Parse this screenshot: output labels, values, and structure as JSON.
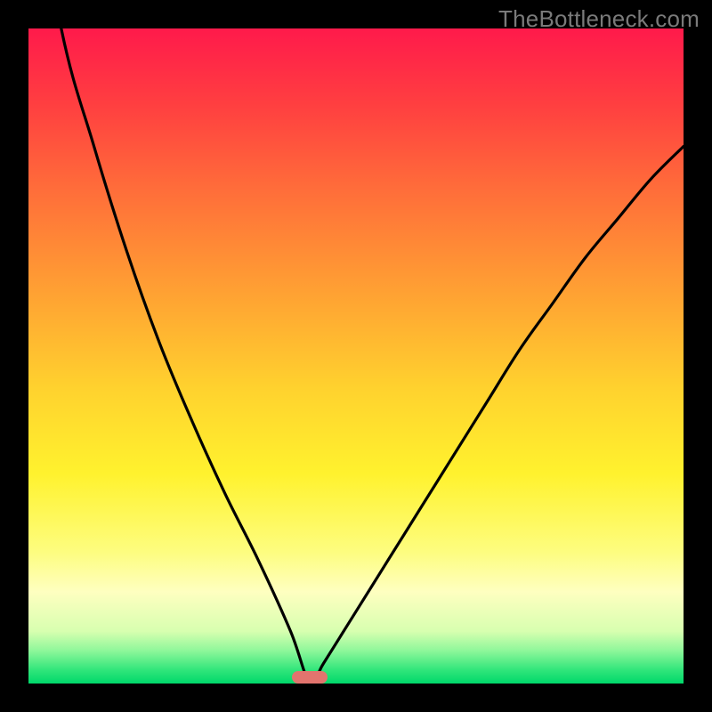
{
  "watermark": "TheBottleneck.com",
  "colors": {
    "frame": "#000000",
    "curve": "#000000",
    "marker": "#e2746e",
    "gradient_top": "#ff1a4b",
    "gradient_bottom": "#00d86a"
  },
  "chart_data": {
    "type": "line",
    "title": "",
    "xlabel": "",
    "ylabel": "",
    "xlim": [
      0,
      100
    ],
    "ylim": [
      0,
      100
    ],
    "grid": false,
    "legend": false,
    "note": "Bottleneck-style curve. Y ≈ 0 at the optimum (green band) and rises toward 100 (red) as x moves away from the optimum. Values are read off the gradient/position; no axis ticks are shown.",
    "optimum_x": 43,
    "series": [
      {
        "name": "bottleneck-curve",
        "x": [
          0,
          5,
          10,
          15,
          20,
          25,
          30,
          35,
          40,
          43,
          45,
          50,
          55,
          60,
          65,
          70,
          75,
          80,
          85,
          90,
          95,
          100
        ],
        "y": [
          130,
          100,
          82,
          66,
          52,
          40,
          29,
          19,
          8,
          0,
          3,
          11,
          19,
          27,
          35,
          43,
          51,
          58,
          65,
          71,
          77,
          82
        ]
      }
    ],
    "marker": {
      "x": 43,
      "y": 0,
      "label": ""
    }
  }
}
